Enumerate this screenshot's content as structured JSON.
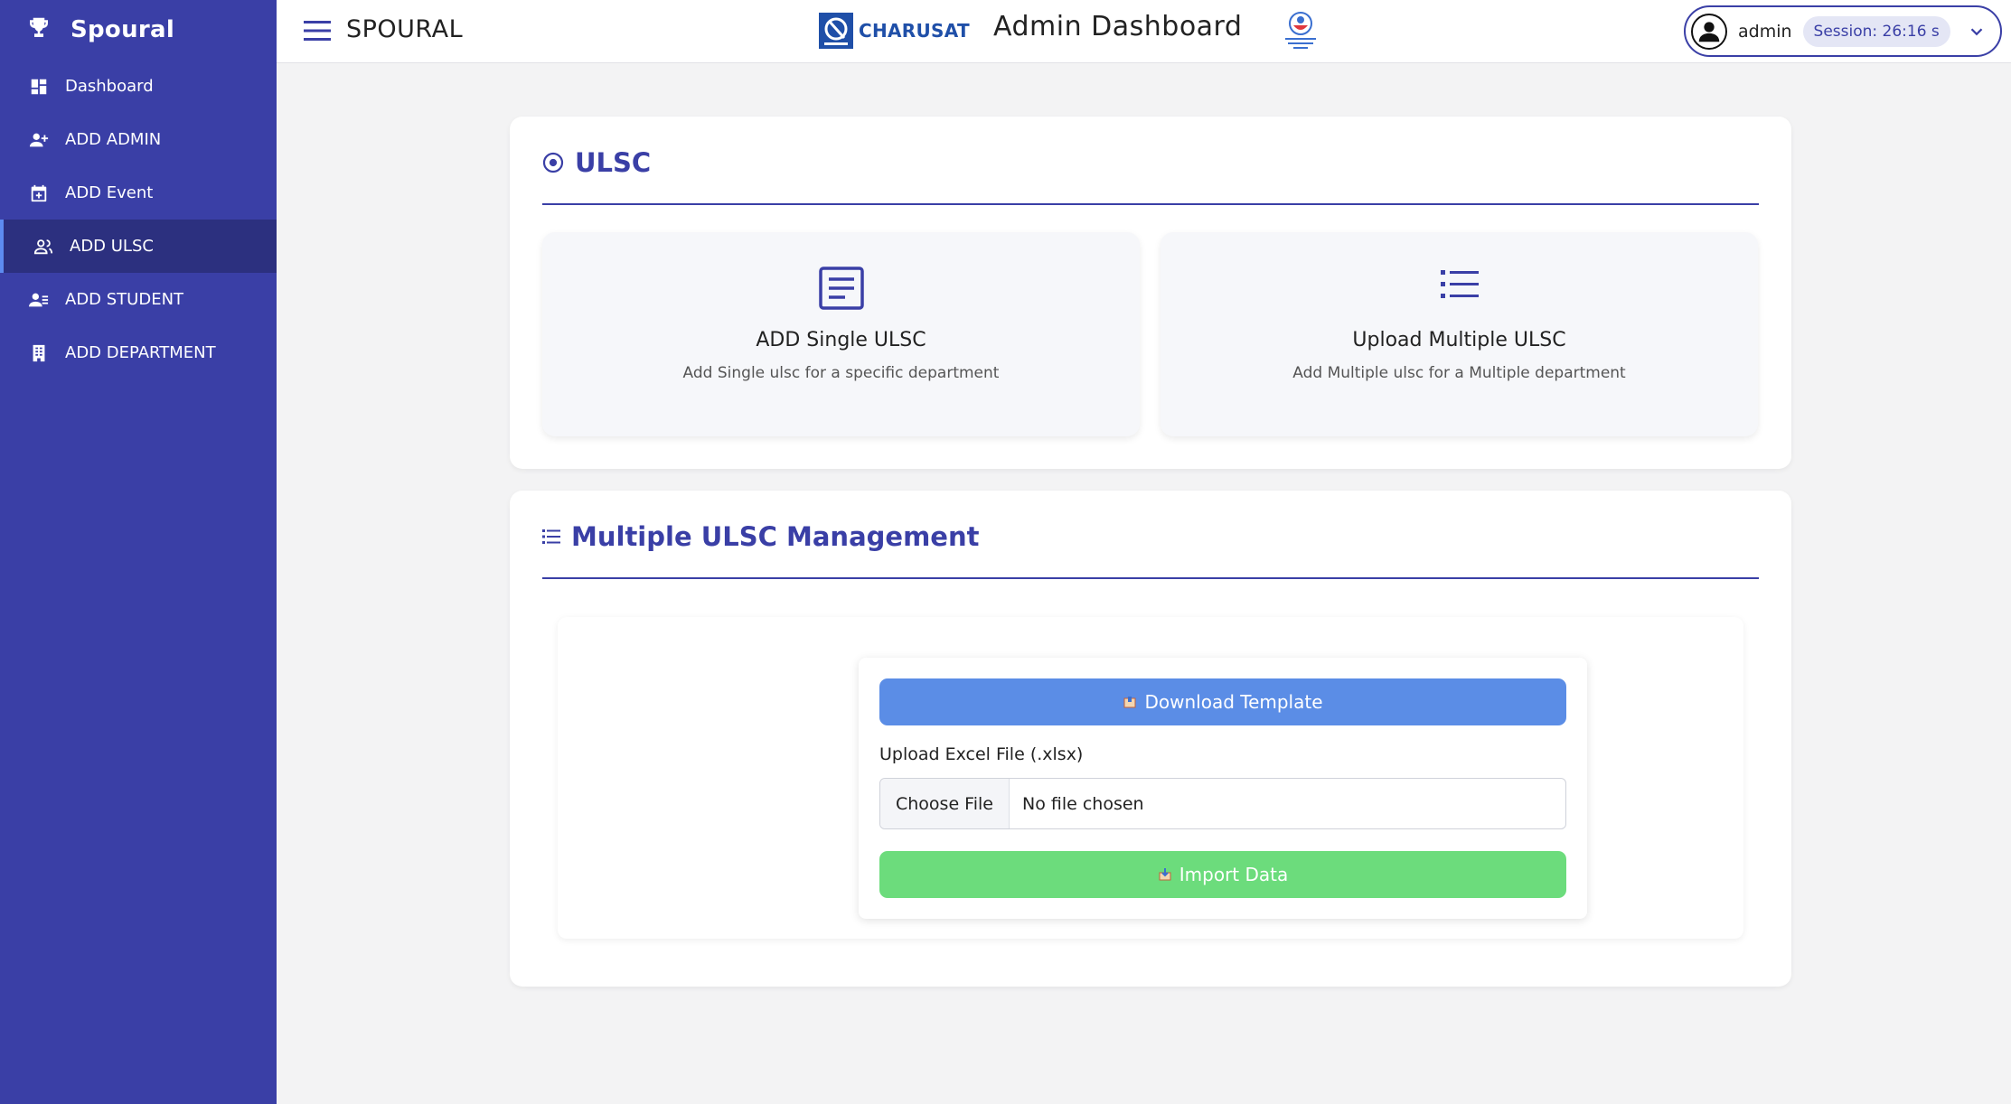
{
  "sidebar": {
    "brand": "Spoural",
    "items": [
      {
        "label": "Dashboard",
        "icon": "dashboard-icon"
      },
      {
        "label": "ADD ADMIN",
        "icon": "add-user-icon"
      },
      {
        "label": "ADD Event",
        "icon": "calendar-plus-icon"
      },
      {
        "label": "ADD ULSC",
        "icon": "users-icon",
        "active": true
      },
      {
        "label": "ADD STUDENT",
        "icon": "student-list-icon"
      },
      {
        "label": "ADD DEPARTMENT",
        "icon": "building-icon"
      }
    ]
  },
  "topbar": {
    "app_name": "SPOURAL",
    "university": "CHARUSAT",
    "page_heading": "Admin Dashboard",
    "user": "admin",
    "session": "Session: 26:16 s"
  },
  "ulsc_card": {
    "title": "ULSC",
    "options": [
      {
        "title": "ADD Single ULSC",
        "description": "Add Single ulsc for a specific department",
        "icon": "document-icon"
      },
      {
        "title": "Upload Multiple ULSC",
        "description": "Add Multiple ulsc for a Multiple department",
        "icon": "list-icon"
      }
    ]
  },
  "management_card": {
    "title": "Multiple ULSC Management",
    "download_label": "Download Template",
    "file_label": "Upload Excel File (.xlsx)",
    "choose_label": "Choose File",
    "file_status": "No file chosen",
    "import_label": "Import Data"
  },
  "colors": {
    "sidebar": "#3a3fa6",
    "sidebar_active": "#2c307f",
    "accent": "#3a3fa6",
    "download_button": "#5b8de6",
    "import_button": "#6cdc7c"
  }
}
